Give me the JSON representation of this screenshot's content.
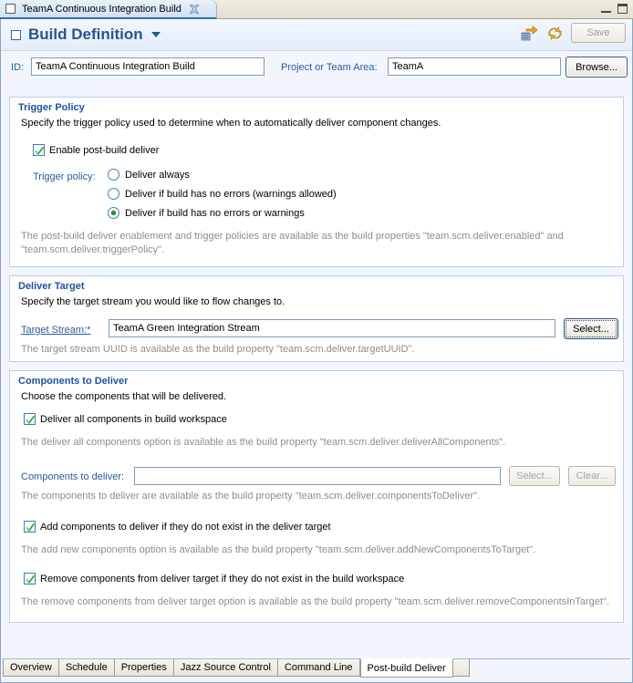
{
  "window": {
    "editor_tab_label": "TeamA Continuous Integration Build",
    "close_icon": "close-icon",
    "minimize_icon": "minimize-icon",
    "maximize_icon": "maximize-icon"
  },
  "header": {
    "title": "Build Definition",
    "caret_icon": "chevron-down-icon",
    "action_icons": [
      "request-build-icon",
      "refresh-icon"
    ],
    "save_label": "Save"
  },
  "id_row": {
    "id_label": "ID:",
    "id_value": "TeamA Continuous Integration Build",
    "area_label": "Project or Team Area:",
    "area_value": "TeamA",
    "browse_label": "Browse..."
  },
  "trigger_policy": {
    "title": "Trigger Policy",
    "description": "Specify the trigger policy used to determine when to automatically deliver component changes.",
    "enable_checkbox_label": "Enable post-build deliver",
    "enable_checked": true,
    "policy_label": "Trigger policy:",
    "options": [
      {
        "label": "Deliver always",
        "selected": false
      },
      {
        "label": "Deliver if build has no errors (warnings allowed)",
        "selected": false
      },
      {
        "label": "Deliver if build has no errors or warnings",
        "selected": true
      }
    ],
    "hint_line1": "The post-build deliver enablement and trigger policies are available as the build properties \"team.scm.deliver.enabled\" and",
    "hint_line2": "\"team.scm.deliver.triggerPolicy\"."
  },
  "deliver_target": {
    "title": "Deliver Target",
    "description": "Specify the target stream you would like to flow changes to.",
    "field_label": "Target Stream:*",
    "field_value": "TeamA Green Integration Stream",
    "select_label": "Select...",
    "hint": "The target stream UUID is available as the build property \"team.scm.deliver.targetUUID\"."
  },
  "components": {
    "title": "Components to Deliver",
    "description": "Choose the components that will be delivered.",
    "deliver_all_label": "Deliver all components in build workspace",
    "deliver_all_checked": true,
    "deliver_all_hint": "The deliver all components option is available as the build property \"team.scm.deliver.deliverAllComponents\".",
    "components_field_label": "Components to deliver:",
    "components_field_value": "",
    "components_select_label": "Select...",
    "components_clear_label": "Clear...",
    "components_hint": "The components to deliver are available as the build property \"team.scm.deliver.componentsToDeliver\".",
    "add_label": "Add components to deliver if they do not exist in the deliver target",
    "add_checked": true,
    "add_hint": "The add new components option is available as the build property \"team.scm.deliver.addNewComponentsToTarget\".",
    "remove_label": "Remove components from deliver target if they do not exist in the build workspace",
    "remove_checked": true,
    "remove_hint": "The remove components from deliver target option is available as the build property \"team.scm.deliver.removeComponentsInTarget\"."
  },
  "bottom_tabs": {
    "items": [
      {
        "label": "Overview",
        "active": false
      },
      {
        "label": "Schedule",
        "active": false
      },
      {
        "label": "Properties",
        "active": false
      },
      {
        "label": "Jazz Source Control",
        "active": false
      },
      {
        "label": "Command Line",
        "active": false
      },
      {
        "label": "Post-build Deliver",
        "active": true
      }
    ]
  },
  "colors": {
    "accent_blue": "#20539d",
    "label_blue": "#2a5a9c",
    "hint_gray": "#8d8d8d",
    "check_green": "#1a9c1a"
  }
}
